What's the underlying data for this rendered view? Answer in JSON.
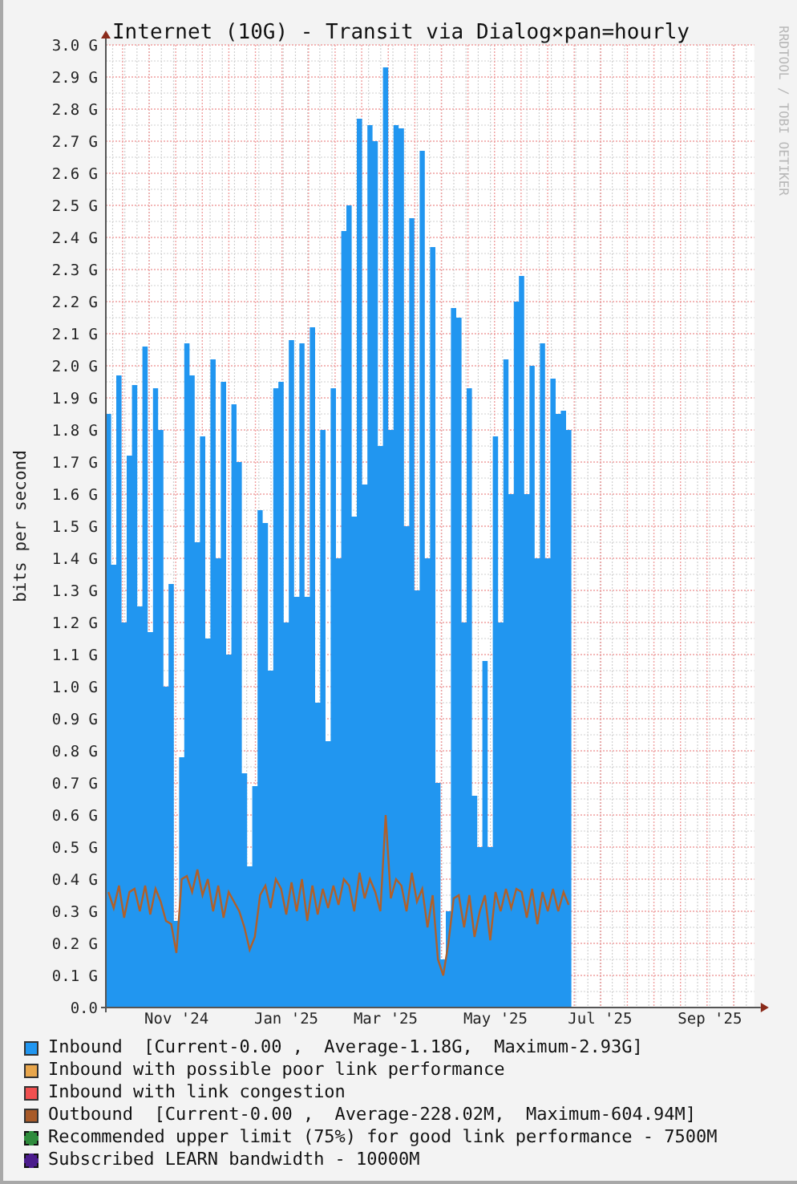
{
  "graph": {
    "credit": "RRDTOOL / TOBI OETIKER",
    "chart_data": {
      "type": "area",
      "grid": true,
      "title": "Internet (10G) - Transit via Dialog×pan=hourly",
      "ylabel": "bits per second",
      "ylim": [
        0,
        3.0
      ],
      "categories": [
        null,
        null,
        null,
        null,
        null,
        null,
        null,
        null,
        null,
        null,
        null,
        null,
        null,
        "Nov '24",
        null,
        null,
        null,
        null,
        null,
        null,
        null,
        null,
        null,
        null,
        null,
        null,
        null,
        null,
        null,
        null,
        null,
        null,
        null,
        null,
        "Jan '25",
        null,
        null,
        null,
        null,
        null,
        null,
        null,
        null,
        null,
        null,
        null,
        null,
        null,
        null,
        null,
        null,
        null,
        null,
        "Mar '25",
        null,
        null,
        null,
        null,
        null,
        null,
        null,
        null,
        null,
        null,
        null,
        null,
        null,
        null,
        null,
        null,
        null,
        null,
        null,
        null,
        "May '25",
        null,
        null,
        null,
        null,
        null,
        null,
        null,
        null,
        null,
        null,
        null,
        null,
        null,
        null,
        null,
        null,
        null,
        null,
        null,
        "Jul '25",
        null,
        null,
        null,
        null,
        null,
        null,
        null,
        null,
        null,
        null,
        null,
        null,
        null,
        null,
        null,
        null,
        null,
        null,
        null,
        null,
        "Sep '25",
        null,
        null,
        null,
        null,
        null,
        null,
        null,
        null
      ],
      "yticks": [
        {
          "value": 0,
          "label": "0.0"
        },
        {
          "value": 0.1,
          "label": "0.1 G"
        },
        {
          "value": 0.2,
          "label": "0.2 G"
        },
        {
          "value": 0.3,
          "label": "0.3 G"
        },
        {
          "value": 0.4,
          "label": "0.4 G"
        },
        {
          "value": 0.5,
          "label": "0.5 G"
        },
        {
          "value": 0.6,
          "label": "0.6 G"
        },
        {
          "value": 0.7,
          "label": "0.7 G"
        },
        {
          "value": 0.8,
          "label": "0.8 G"
        },
        {
          "value": 0.9,
          "label": "0.9 G"
        },
        {
          "value": 1.0,
          "label": "1.0 G"
        },
        {
          "value": 1.1,
          "label": "1.1 G"
        },
        {
          "value": 1.2,
          "label": "1.2 G"
        },
        {
          "value": 1.3,
          "label": "1.3 G"
        },
        {
          "value": 1.4,
          "label": "1.4 G"
        },
        {
          "value": 1.5,
          "label": "1.5 G"
        },
        {
          "value": 1.6,
          "label": "1.6 G"
        },
        {
          "value": 1.7,
          "label": "1.7 G"
        },
        {
          "value": 1.8,
          "label": "1.8 G"
        },
        {
          "value": 1.9,
          "label": "1.9 G"
        },
        {
          "value": 2.0,
          "label": "2.0 G"
        },
        {
          "value": 2.1,
          "label": "2.1 G"
        },
        {
          "value": 2.2,
          "label": "2.2 G"
        },
        {
          "value": 2.3,
          "label": "2.3 G"
        },
        {
          "value": 2.4,
          "label": "2.4 G"
        },
        {
          "value": 2.5,
          "label": "2.5 G"
        },
        {
          "value": 2.6,
          "label": "2.6 G"
        },
        {
          "value": 2.7,
          "label": "2.7 G"
        },
        {
          "value": 2.8,
          "label": "2.8 G"
        },
        {
          "value": 2.9,
          "label": "2.9 G"
        },
        {
          "value": 3.0,
          "label": "3.0 G"
        }
      ],
      "series": [
        {
          "color": "#2196f0",
          "values": [
            1.85,
            1.38,
            1.97,
            1.2,
            1.72,
            1.94,
            1.25,
            2.06,
            1.17,
            1.93,
            1.8,
            1.0,
            1.32,
            0.27,
            0.78,
            2.07,
            1.97,
            1.45,
            1.78,
            1.15,
            2.02,
            1.4,
            1.95,
            1.1,
            1.88,
            1.7,
            0.73,
            0.44,
            0.69,
            1.55,
            1.51,
            1.05,
            1.93,
            1.95,
            1.2,
            2.08,
            1.28,
            2.07,
            1.28,
            2.12,
            0.95,
            1.8,
            0.83,
            1.93,
            1.4,
            2.42,
            2.5,
            1.53,
            2.77,
            1.63,
            2.75,
            2.7,
            1.75,
            2.93,
            1.8,
            2.75,
            2.74,
            1.5,
            2.46,
            1.3,
            2.67,
            1.4,
            2.37,
            0.7,
            0.15,
            0.3,
            2.18,
            2.15,
            1.2,
            1.93,
            0.66,
            0.5,
            1.08,
            0.5,
            1.78,
            1.2,
            2.02,
            1.6,
            2.2,
            2.28,
            1.6,
            2.0,
            1.4,
            2.07,
            1.4,
            1.96,
            1.85,
            1.86,
            1.8,
            null,
            null,
            null,
            null,
            null,
            null,
            null,
            null,
            null,
            null,
            null,
            null,
            null,
            null,
            null,
            null,
            null,
            null,
            null,
            null,
            null,
            null,
            null,
            null,
            null,
            null,
            null,
            null,
            null,
            null,
            null,
            null,
            null,
            null,
            null
          ]
        },
        {
          "type": "line",
          "color": "#b0602a",
          "values": [
            0.36,
            0.31,
            0.38,
            0.28,
            0.36,
            0.37,
            0.3,
            0.38,
            0.29,
            0.37,
            0.33,
            0.27,
            0.26,
            0.17,
            0.4,
            0.41,
            0.36,
            0.43,
            0.35,
            0.4,
            0.3,
            0.38,
            0.28,
            0.36,
            0.33,
            0.3,
            0.25,
            0.18,
            0.22,
            0.35,
            0.38,
            0.31,
            0.4,
            0.37,
            0.29,
            0.39,
            0.3,
            0.4,
            0.27,
            0.38,
            0.29,
            0.37,
            0.31,
            0.38,
            0.32,
            0.4,
            0.38,
            0.3,
            0.42,
            0.34,
            0.4,
            0.36,
            0.3,
            0.6,
            0.34,
            0.4,
            0.38,
            0.3,
            0.42,
            0.33,
            0.37,
            0.25,
            0.35,
            0.15,
            0.1,
            0.2,
            0.34,
            0.35,
            0.25,
            0.35,
            0.22,
            0.3,
            0.35,
            0.21,
            0.36,
            0.3,
            0.37,
            0.31,
            0.37,
            0.36,
            0.28,
            0.37,
            0.26,
            0.36,
            0.3,
            0.37,
            0.3,
            0.36,
            0.32,
            null,
            null,
            null,
            null,
            null,
            null,
            null,
            null,
            null,
            null,
            null,
            null,
            null,
            null,
            null,
            null,
            null,
            null,
            null,
            null,
            null,
            null,
            null,
            null,
            null,
            null,
            null,
            null,
            null,
            null,
            null,
            null,
            null,
            null,
            null
          ]
        }
      ]
    }
  },
  "legend": [
    {
      "kind": "solid",
      "color": "#2196f0",
      "text": "Inbound  [Current-0.00 ,  Average-1.18G,  Maximum-2.93G]"
    },
    {
      "kind": "solid",
      "color": "#e8a64c",
      "text": "Inbound with possible poor link performance"
    },
    {
      "kind": "solid",
      "color": "#f05050",
      "text": "Inbound with link congestion"
    },
    {
      "kind": "solid",
      "color": "#a85a28",
      "text": "Outbound  [Current-0.00 ,  Average-228.02M,  Maximum-604.94M]"
    },
    {
      "kind": "dashed",
      "color": "#2e8b3c",
      "text": "Recommended upper limit (75%) for good link performance - 7500M"
    },
    {
      "kind": "dashed",
      "color": "#4b1c8c",
      "text": "Subscribed LEARN bandwidth - 10000M"
    }
  ]
}
